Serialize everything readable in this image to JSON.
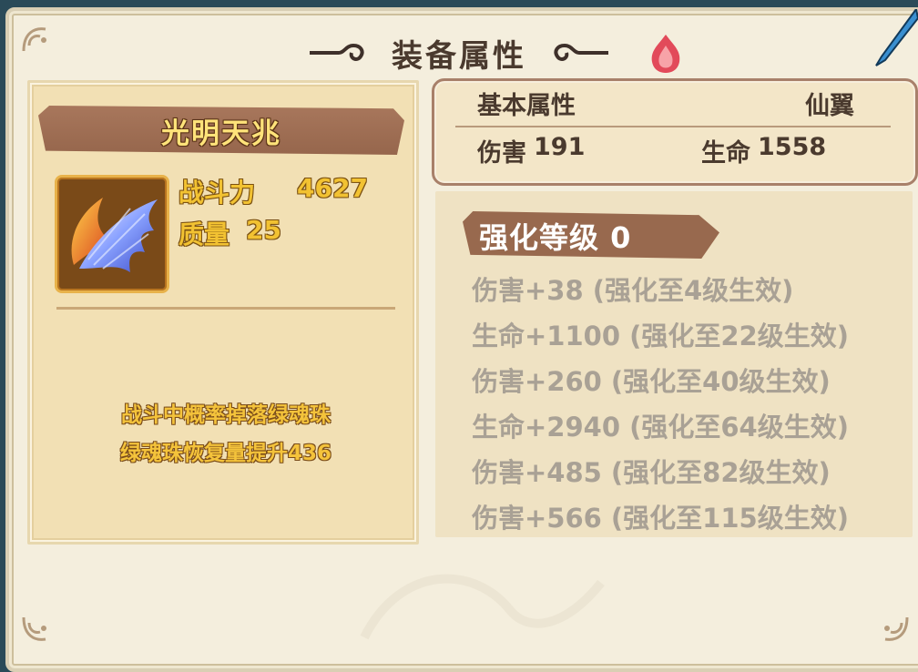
{
  "header": {
    "title": "装备属性"
  },
  "item": {
    "name": "光明天兆",
    "icon": "wing-icon",
    "power_label": "战斗力",
    "power_value": "4627",
    "quality_label": "质量",
    "quality_value": "25",
    "skill_lines": [
      "战斗中概率掉落绿魂珠",
      "绿魂珠恢复量提升436"
    ]
  },
  "base_attributes": {
    "title": "基本属性",
    "type": "仙翼",
    "damage_label": "伤害",
    "damage_value": "191",
    "life_label": "生命",
    "life_value": "1558"
  },
  "enhancement": {
    "title": "强化等级 0",
    "rows": [
      "伤害+38 (强化至4级生效)",
      "生命+1100 (强化至22级生效)",
      "伤害+260 (强化至40级生效)",
      "生命+2940 (强化至64级生效)",
      "伤害+485 (强化至82级生效)",
      "伤害+566 (强化至115级生效)"
    ]
  },
  "colors": {
    "panel": "#f2e0b4",
    "banner": "#98694e",
    "gold_text": "#f2c232",
    "inactive_text": "#a9a195"
  }
}
